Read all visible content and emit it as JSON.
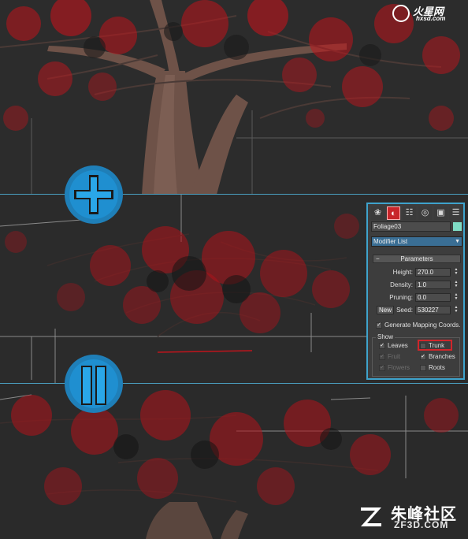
{
  "watermark_top": {
    "brand_cn": "火星网",
    "brand_url": "hxsd.com"
  },
  "watermark_bottom": {
    "brand_cn": "朱峰社区",
    "brand_url": "ZF3D.COM"
  },
  "steps": {
    "plus_symbol": "plus",
    "equals_symbol": "equals"
  },
  "modify_panel": {
    "tabs": [
      {
        "icon": "create-icon",
        "glyph": "❀"
      },
      {
        "icon": "modify-icon",
        "glyph": "◐",
        "active": true
      },
      {
        "icon": "hierarchy-icon",
        "glyph": "☷"
      },
      {
        "icon": "motion-icon",
        "glyph": "◎"
      },
      {
        "icon": "display-icon",
        "glyph": "▣"
      },
      {
        "icon": "utilities-icon",
        "glyph": "☰"
      }
    ],
    "object_name": "Foliage03",
    "object_color": "#7fdcc5",
    "modifier_list": "Modifier List",
    "rollout_title": "Parameters",
    "rollout_toggle": "−",
    "height_label": "Height:",
    "height_value": "270.0",
    "density_label": "Density:",
    "density_value": "1.0",
    "pruning_label": "Pruning:",
    "pruning_value": "0.0",
    "new_button": "New",
    "seed_label": "Seed:",
    "seed_value": "530227",
    "mapping_label": "Generate Mapping Coords.",
    "mapping_checked": true,
    "show_title": "Show",
    "show": {
      "leaves": {
        "label": "Leaves",
        "checked": true,
        "enabled": true
      },
      "trunk": {
        "label": "Trunk",
        "checked": false,
        "enabled": true,
        "highlighted": true
      },
      "fruit": {
        "label": "Fruit",
        "checked": true,
        "enabled": false
      },
      "branches": {
        "label": "Branches",
        "checked": true,
        "enabled": true
      },
      "flowers": {
        "label": "Flowers",
        "checked": true,
        "enabled": false
      },
      "roots": {
        "label": "Roots",
        "checked": false,
        "enabled": true
      }
    },
    "accent_color": "#3ea3cc",
    "highlight_color": "#d0262b"
  }
}
